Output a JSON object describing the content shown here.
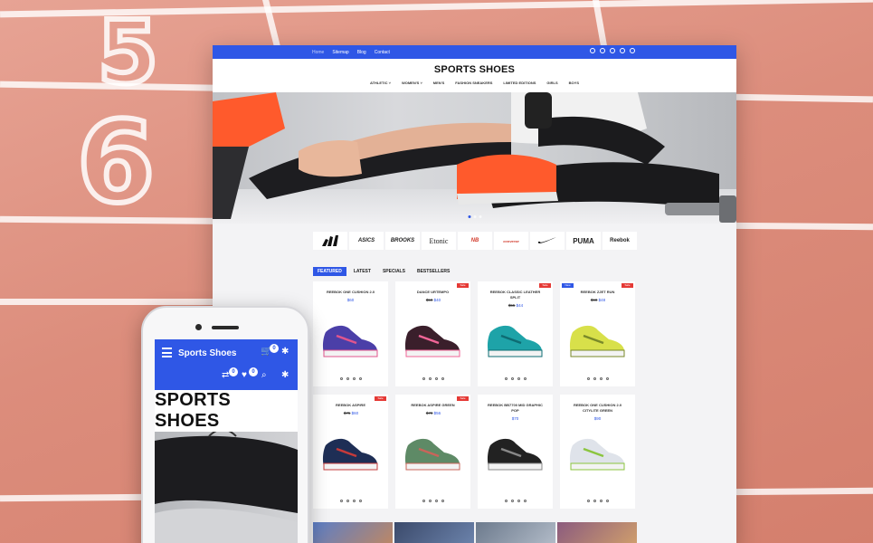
{
  "desktop": {
    "topbar_links": [
      "Home",
      "Sitemap",
      "Blog",
      "Contact"
    ],
    "logo": "SPORTS SHOES",
    "nav": [
      "ATHLETIC ˅",
      "WOMEN'S ˅",
      "MEN'S",
      "FASHION SNEAKERS",
      "LIMITED EDITIONS",
      "GIRLS",
      "BOYS"
    ],
    "brands": [
      "adidas-logo",
      "ASICS",
      "BROOKS",
      "Etonic",
      "NB",
      "converse",
      "nike-logo",
      "PUMA",
      "Reebok"
    ],
    "tabs": [
      "FEATURED",
      "LATEST",
      "SPECIALS",
      "BESTSELLERS"
    ],
    "products": [
      {
        "name": "REEBOK ONE CUSHION 2.0",
        "price": "$60",
        "old": "",
        "badge": "",
        "color": "#4b3fa8",
        "accent": "#e0558d"
      },
      {
        "name": "DANCE URTEMPO",
        "price": "$40",
        "old": "$50",
        "badge": "Sale",
        "color": "#3a1f2b",
        "accent": "#f06597"
      },
      {
        "name": "REEBOK CLASSIC LEATHER SPLIT",
        "price": "$44",
        "old": "$55",
        "badge": "Sale",
        "color": "#1ea3a8",
        "accent": "#0e6c73"
      },
      {
        "name": "REEBOK ZJET RUN",
        "price": "$48",
        "old": "$60",
        "badge": "Sale",
        "badge_new": "New",
        "color": "#d8e04a",
        "accent": "#7a8a2a"
      },
      {
        "name": "REEBOK ASPIRE",
        "price": "$60",
        "old": "$75",
        "badge": "Sale",
        "color": "#1e2e55",
        "accent": "#c63a3a"
      },
      {
        "name": "REEBOK ASPIRE GREEN",
        "price": "$56",
        "old": "$70",
        "badge": "Sale",
        "color": "#5e8a66",
        "accent": "#c9645a"
      },
      {
        "name": "REEBOK BB7700 MID GRAPHIC POP",
        "price": "$70",
        "old": "",
        "badge": "",
        "color": "#222",
        "accent": "#888"
      },
      {
        "name": "REEBOK ONE CUSHION 2.0 CITYLITE GREEN",
        "price": "$90",
        "old": "",
        "badge": "",
        "color": "#dfe3ea",
        "accent": "#8bc53f"
      }
    ]
  },
  "mobile": {
    "title": "Sports Shoes",
    "cart_count": "0",
    "compare_count": "0",
    "wishlist_count": "0",
    "logo": "SPORTS SHOES"
  },
  "colors": {
    "accent": "#2f57e6",
    "sale": "#e53935"
  }
}
